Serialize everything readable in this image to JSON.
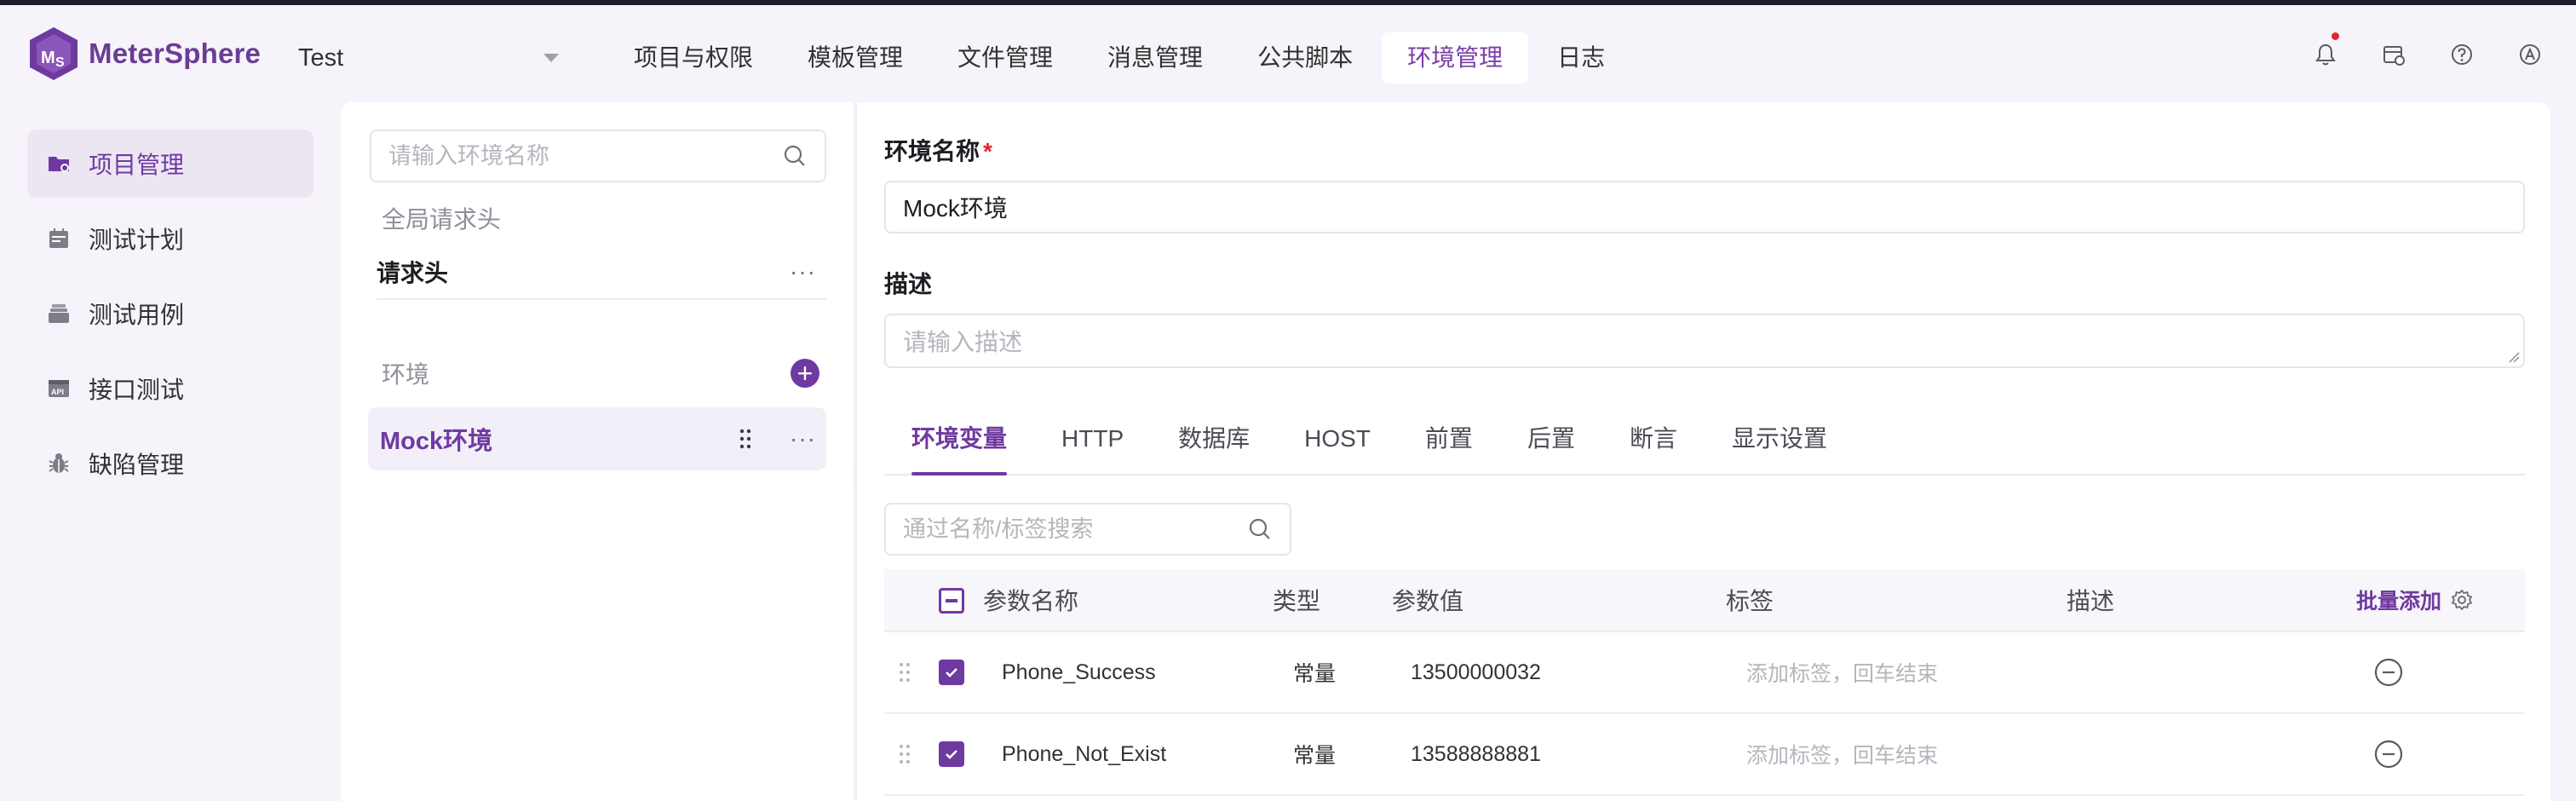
{
  "app": {
    "brand": "MeterSphere",
    "project": "Test"
  },
  "topnav": {
    "items": [
      {
        "label": "项目与权限",
        "active": false
      },
      {
        "label": "模板管理",
        "active": false
      },
      {
        "label": "文件管理",
        "active": false
      },
      {
        "label": "消息管理",
        "active": false
      },
      {
        "label": "公共脚本",
        "active": false
      },
      {
        "label": "环境管理",
        "active": true
      },
      {
        "label": "日志",
        "active": false
      }
    ]
  },
  "sidebar": {
    "items": [
      {
        "label": "项目管理",
        "icon": "folder-icon",
        "active": true
      },
      {
        "label": "测试计划",
        "icon": "calendar-icon",
        "active": false
      },
      {
        "label": "测试用例",
        "icon": "stack-icon",
        "active": false
      },
      {
        "label": "接口测试",
        "icon": "api-icon",
        "active": false
      },
      {
        "label": "缺陷管理",
        "icon": "bug-icon",
        "active": false
      }
    ]
  },
  "leftpanel": {
    "search_placeholder": "请输入环境名称",
    "global_header": "全局请求头",
    "request_header": "请求头",
    "env_group": "环境",
    "selected_env": "Mock环境",
    "more": "···"
  },
  "form": {
    "name_label": "环境名称",
    "required_mark": "*",
    "name_value": "Mock环境",
    "desc_label": "描述",
    "desc_placeholder": "请输入描述"
  },
  "tabs": [
    "环境变量",
    "HTTP",
    "数据库",
    "HOST",
    "前置",
    "后置",
    "断言",
    "显示设置"
  ],
  "var_search_placeholder": "通过名称/标签搜索",
  "table": {
    "headers": {
      "name": "参数名称",
      "type": "类型",
      "value": "参数值",
      "tag": "标签",
      "desc": "描述",
      "batch": "批量添加"
    },
    "rows": [
      {
        "name": "Phone_Success",
        "type": "常量",
        "value": "13500000032",
        "tag_placeholder": "添加标签，回车结束",
        "checked": true
      },
      {
        "name": "Phone_Not_Exist",
        "type": "常量",
        "value": "13588888881",
        "tag_placeholder": "添加标签，回车结束",
        "checked": true
      }
    ]
  },
  "colors": {
    "accent": "#6f3aa0",
    "required": "#e0242d",
    "background": "#f6f4fa"
  }
}
